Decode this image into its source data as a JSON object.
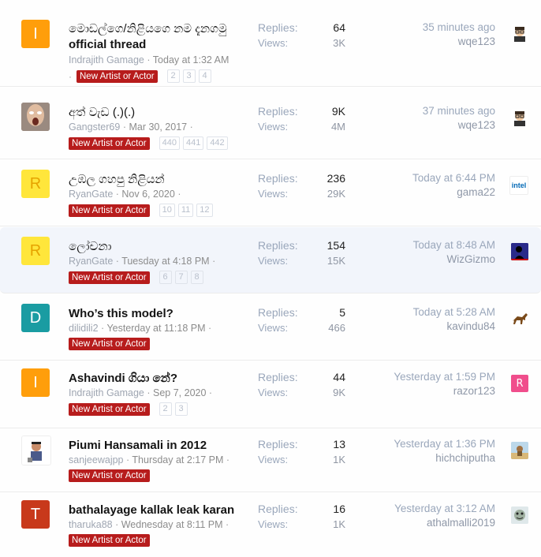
{
  "threads": [
    {
      "avatar_letter": "I",
      "avatar_color": "#ff9e0b",
      "title": "මොඩල්ගෙ/නිළියගෙ නම දැනගමු official thread",
      "title_line1": "මොඩල්ගෙ/නිළියගෙ නම දැනගමු",
      "title_line2": "official thread",
      "author": "Indrajith Gamage",
      "date": "Today at 1:32 AM",
      "tag": "New Artist or Actor",
      "pages": [
        "2",
        "3",
        "4"
      ],
      "replies_label": "Replies:",
      "replies": "64",
      "views_label": "Views:",
      "views": "3K",
      "last_time": "35 minutes ago",
      "last_user": "wqe123",
      "last_avatar": "person-glasses-icon"
    },
    {
      "avatar_letter": "",
      "avatar_color": "#8a7c74",
      "title": "අත් වැඩ (.)(.)",
      "author": "Gangster69",
      "date": "Mar 30, 2017",
      "tag": "New Artist or Actor",
      "pages": [
        "440",
        "441",
        "442"
      ],
      "replies_label": "Replies:",
      "replies": "9K",
      "views_label": "Views:",
      "views": "4M",
      "last_time": "37 minutes ago",
      "last_user": "wqe123",
      "last_avatar": "person-glasses-icon"
    },
    {
      "avatar_letter": "R",
      "avatar_color": "#ffe63b",
      "title": "උඹල ගහපු නිළියන්",
      "author": "RyanGate",
      "date": "Nov 6, 2020",
      "tag": "New Artist or Actor",
      "pages": [
        "10",
        "11",
        "12"
      ],
      "replies_label": "Replies:",
      "replies": "236",
      "views_label": "Views:",
      "views": "29K",
      "last_time": "Today at 6:44 PM",
      "last_user": "gama22",
      "last_avatar": "intel-logo-icon",
      "last_avatar_text": "intel"
    },
    {
      "avatar_letter": "R",
      "avatar_color": "#ffe63b",
      "title": "ලෝචනා",
      "author": "RyanGate",
      "date": "Tuesday at 4:18 PM",
      "tag": "New Artist or Actor",
      "pages": [
        "6",
        "7",
        "8"
      ],
      "replies_label": "Replies:",
      "replies": "154",
      "views_label": "Views:",
      "views": "15K",
      "last_time": "Today at 8:48 AM",
      "last_user": "WizGizmo",
      "last_avatar": "silhouette-icon"
    },
    {
      "avatar_letter": "D",
      "avatar_color": "#1a9ca2",
      "title": "Who’s this model?",
      "author": "dilidili2",
      "date": "Yesterday at 11:18 PM",
      "tag": "New Artist or Actor",
      "pages": [],
      "replies_label": "Replies:",
      "replies": "5",
      "views_label": "Views:",
      "views": "466",
      "last_time": "Today at 5:28 AM",
      "last_user": "kavindu84",
      "last_avatar": "horse-icon"
    },
    {
      "avatar_letter": "I",
      "avatar_color": "#ff9e0b",
      "title": "Ashavindi ගියා නේ?",
      "author": "Indrajith Gamage",
      "date": "Sep 7, 2020",
      "tag": "New Artist or Actor",
      "pages": [
        "2",
        "3"
      ],
      "replies_label": "Replies:",
      "replies": "44",
      "views_label": "Views:",
      "views": "9K",
      "last_time": "Yesterday at 1:59 PM",
      "last_user": "razor123",
      "last_avatar": "letter-r-icon",
      "last_avatar_text": "R"
    },
    {
      "avatar_letter": "",
      "avatar_color": "#ffffff",
      "title": "Piumi Hansamali in 2012",
      "author": "sanjeewajpp",
      "date": "Thursday at 2:17 PM",
      "tag": "New Artist or Actor",
      "pages": [],
      "replies_label": "Replies:",
      "replies": "13",
      "views_label": "Views:",
      "views": "1K",
      "last_time": "Yesterday at 1:36 PM",
      "last_user": "hichchiputha",
      "last_avatar": "cartoon-icon"
    },
    {
      "avatar_letter": "T",
      "avatar_color": "#c8391b",
      "title": "bathalayage kallak leak karan",
      "author": "tharuka88",
      "date": "Wednesday at 8:11 PM",
      "tag": "New Artist or Actor",
      "pages": [],
      "replies_label": "Replies:",
      "replies": "16",
      "views_label": "Views:",
      "views": "1K",
      "last_time": "Yesterday at 3:12 AM",
      "last_user": "athalmalli2019",
      "last_avatar": "face-icon"
    }
  ]
}
